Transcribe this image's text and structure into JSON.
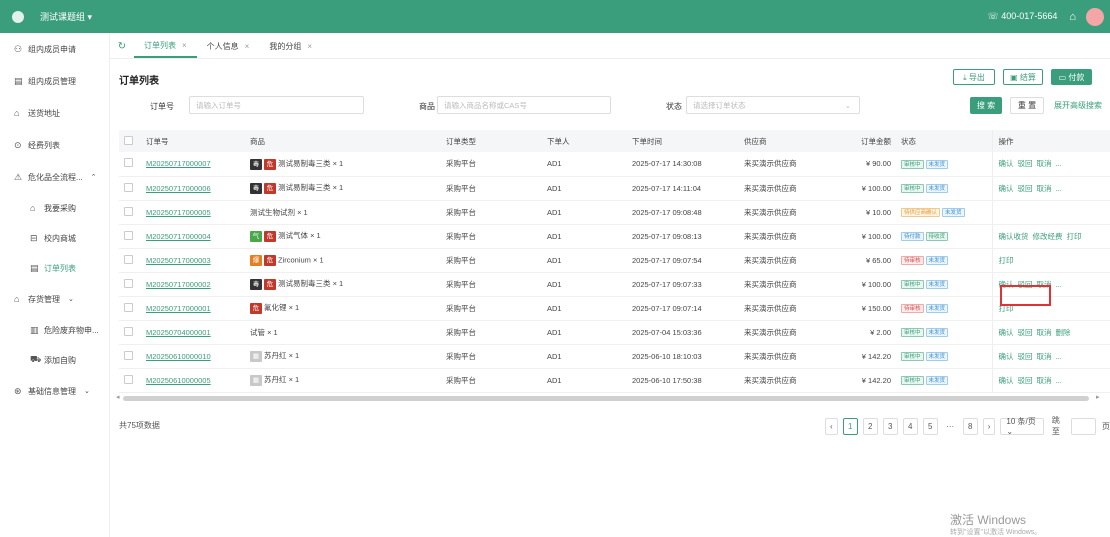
{
  "topbar": {
    "group": "测试课题组 ▾",
    "phone": "☏ 400-017-5664"
  },
  "sidebar": {
    "items": [
      {
        "icon": "group-members-icon",
        "label": "组内成员申请"
      },
      {
        "icon": "members-manage-icon",
        "label": "组内成员管理"
      },
      {
        "icon": "delivery-icon",
        "label": "送货地址"
      },
      {
        "icon": "expense-icon",
        "label": "经费列表"
      },
      {
        "icon": "hazard-icon",
        "label": "危化品全流程...",
        "arrow": "⌃"
      },
      {
        "icon": "purchase-icon",
        "label": "我要采购",
        "sub": true
      },
      {
        "icon": "campus-store-icon",
        "label": "校内商城",
        "sub": true
      },
      {
        "icon": "order-list-icon",
        "label": "订单列表",
        "sub": true,
        "active": true
      },
      {
        "icon": "inventory-icon",
        "label": "存货管理",
        "arrow": "⌄"
      },
      {
        "icon": "waste-icon",
        "label": "危险废弃物申...",
        "sub": true
      },
      {
        "icon": "cart-icon",
        "label": "添加自购",
        "sub": true
      },
      {
        "icon": "basic-info-icon",
        "label": "基础信息管理",
        "arrow": "⌄"
      }
    ]
  },
  "tabs": [
    {
      "label": "订单列表",
      "active": true
    },
    {
      "label": "个人信息"
    },
    {
      "label": "我的分组"
    }
  ],
  "page": {
    "title": "订单列表",
    "export": "⤓ 导出",
    "settle": "▣ 结算",
    "pay": "▭ 付款"
  },
  "filters": {
    "order_label": "订单号",
    "order_placeholder": "请输入订单号",
    "product_label": "商品",
    "product_placeholder": "请输入商品名称或CAS号",
    "status_label": "状态",
    "status_placeholder": "请选择订单状态",
    "search": "搜 索",
    "reset": "重 置",
    "advanced": "展开高级搜索"
  },
  "table": {
    "headers": [
      "订单号",
      "商品",
      "订单类型",
      "下单人",
      "下单时间",
      "供应商",
      "订单金额",
      "状态",
      "操作"
    ],
    "rows": [
      {
        "id": "M20250717000007",
        "badges": [
          {
            "t": "毒",
            "c": "#333"
          },
          {
            "t": "危",
            "c": "#c0392b"
          }
        ],
        "product": "测试易制毒三类 × 1",
        "type": "采购平台",
        "user": "AD1",
        "time": "2025-07-17 14:30:08",
        "supplier": "来买演示供应商",
        "amount": "¥ 90.00",
        "status": [
          {
            "t": "审核中",
            "k": "g"
          },
          {
            "t": "未发货",
            "k": "b"
          }
        ],
        "ops": [
          "确认",
          "驳回",
          "取消",
          "..."
        ]
      },
      {
        "id": "M20250717000006",
        "badges": [
          {
            "t": "毒",
            "c": "#333"
          },
          {
            "t": "危",
            "c": "#c0392b"
          }
        ],
        "product": "测试易制毒三类 × 1",
        "type": "采购平台",
        "user": "AD1",
        "time": "2025-07-17 14:11:04",
        "supplier": "来买演示供应商",
        "amount": "¥ 100.00",
        "status": [
          {
            "t": "审核中",
            "k": "g"
          },
          {
            "t": "未发货",
            "k": "b"
          }
        ],
        "ops": [
          "确认",
          "驳回",
          "取消",
          "..."
        ]
      },
      {
        "id": "M20250717000005",
        "badges": [],
        "product": "测试生物试剂 × 1",
        "type": "采购平台",
        "user": "AD1",
        "time": "2025-07-17 09:08:48",
        "supplier": "来买演示供应商",
        "amount": "¥ 10.00",
        "status": [
          {
            "t": "待供应商确认",
            "k": "o"
          },
          {
            "t": "未发货",
            "k": "b"
          }
        ],
        "ops": []
      },
      {
        "id": "M20250717000004",
        "badges": [
          {
            "t": "气",
            "c": "#4aa84a"
          },
          {
            "t": "危",
            "c": "#c0392b"
          }
        ],
        "product": "测试气体 × 1",
        "type": "采购平台",
        "user": "AD1",
        "time": "2025-07-17 09:08:13",
        "supplier": "来买演示供应商",
        "amount": "¥ 100.00",
        "status": [
          {
            "t": "待付款",
            "k": "b"
          },
          {
            "t": "待收货",
            "k": "g"
          }
        ],
        "ops": [
          "确认收货",
          "修改经费",
          "打印"
        ]
      },
      {
        "id": "M20250717000003",
        "badges": [
          {
            "t": "爆",
            "c": "#e67e22"
          },
          {
            "t": "危",
            "c": "#c0392b"
          }
        ],
        "product": "Zirconium × 1",
        "type": "采购平台",
        "user": "AD1",
        "time": "2025-07-17 09:07:54",
        "supplier": "来买演示供应商",
        "amount": "¥ 65.00",
        "status": [
          {
            "t": "待审核",
            "k": "r"
          },
          {
            "t": "未发货",
            "k": "b"
          }
        ],
        "ops": [
          "打印"
        ]
      },
      {
        "id": "M20250717000002",
        "badges": [
          {
            "t": "毒",
            "c": "#333"
          },
          {
            "t": "危",
            "c": "#c0392b"
          }
        ],
        "product": "测试易制毒三类 × 1",
        "type": "采购平台",
        "user": "AD1",
        "time": "2025-07-17 09:07:33",
        "supplier": "来买演示供应商",
        "amount": "¥ 100.00",
        "status": [
          {
            "t": "审核中",
            "k": "g"
          },
          {
            "t": "未发货",
            "k": "b"
          }
        ],
        "ops": [
          "确认",
          "驳回",
          "取消",
          "..."
        ]
      },
      {
        "id": "M20250717000001",
        "badges": [
          {
            "t": "危",
            "c": "#c0392b"
          }
        ],
        "product": "氟化锂 × 1",
        "type": "采购平台",
        "user": "AD1",
        "time": "2025-07-17 09:07:14",
        "supplier": "来买演示供应商",
        "amount": "¥ 150.00",
        "status": [
          {
            "t": "待审核",
            "k": "r"
          },
          {
            "t": "未发货",
            "k": "b"
          }
        ],
        "ops": [
          "打印"
        ]
      },
      {
        "id": "M20250704000001",
        "badges": [],
        "product": "试管 × 1",
        "type": "采购平台",
        "user": "AD1",
        "time": "2025-07-04 15:03:36",
        "supplier": "来买演示供应商",
        "amount": "¥ 2.00",
        "status": [
          {
            "t": "审核中",
            "k": "g"
          },
          {
            "t": "未发货",
            "k": "b"
          }
        ],
        "ops": [
          "确认",
          "驳回",
          "取消",
          "删除"
        ]
      },
      {
        "id": "M20250610000010",
        "badges": [
          {
            "t": "▦",
            "c": "#c8c8c8"
          }
        ],
        "product": "苏丹红 × 1",
        "type": "采购平台",
        "user": "AD1",
        "time": "2025-06-10 18:10:03",
        "supplier": "来买演示供应商",
        "amount": "¥ 142.20",
        "status": [
          {
            "t": "审核中",
            "k": "g"
          },
          {
            "t": "未发货",
            "k": "b"
          }
        ],
        "ops": [
          "确认",
          "驳回",
          "取消",
          "..."
        ]
      },
      {
        "id": "M20250610000005",
        "badges": [
          {
            "t": "▦",
            "c": "#c8c8c8"
          }
        ],
        "product": "苏丹红 × 1",
        "type": "采购平台",
        "user": "AD1",
        "time": "2025-06-10 17:50:38",
        "supplier": "来买演示供应商",
        "amount": "¥ 142.20",
        "status": [
          {
            "t": "审核中",
            "k": "g"
          },
          {
            "t": "未发货",
            "k": "b"
          }
        ],
        "ops": [
          "确认",
          "驳回",
          "取消",
          "..."
        ]
      }
    ]
  },
  "footer": {
    "total": "共75项数据",
    "pages": [
      "1",
      "2",
      "3",
      "4",
      "5",
      "···",
      "8"
    ],
    "page_size": "10 条/页 ⌄",
    "goto": "跳至",
    "page_unit": "页"
  },
  "watermark": {
    "title": "激活 Windows",
    "sub": "转到\"设置\"以激活 Windows。"
  }
}
